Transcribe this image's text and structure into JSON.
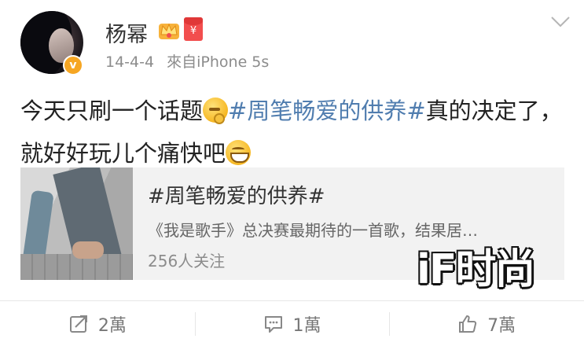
{
  "post": {
    "author": "杨幂",
    "verified_badge": "v",
    "crown_icon": "crown-icon",
    "redpacket_label": "¥",
    "date": "14-4-4",
    "source": "來自iPhone 5s",
    "content": {
      "text_before": "今天只刷一个话题",
      "emoji1": "thinking-emoji",
      "topic": "#周笔畅爱的供养#",
      "text_after": "真的决定了，就好好玩儿个痛快吧",
      "emoji2": "grin-emoji"
    },
    "card": {
      "title": "#周笔畅爱的供养#",
      "description": "《我是歌手》总决赛最期待的一首歌，结果居…",
      "followers": "256人关注"
    },
    "watermark": "iF时尚"
  },
  "actions": {
    "repost": "2萬",
    "comment": "1萬",
    "like": "7萬"
  },
  "colors": {
    "topic": "#507daf",
    "badge": "#f6a623",
    "redpacket": "#f24e4e"
  }
}
